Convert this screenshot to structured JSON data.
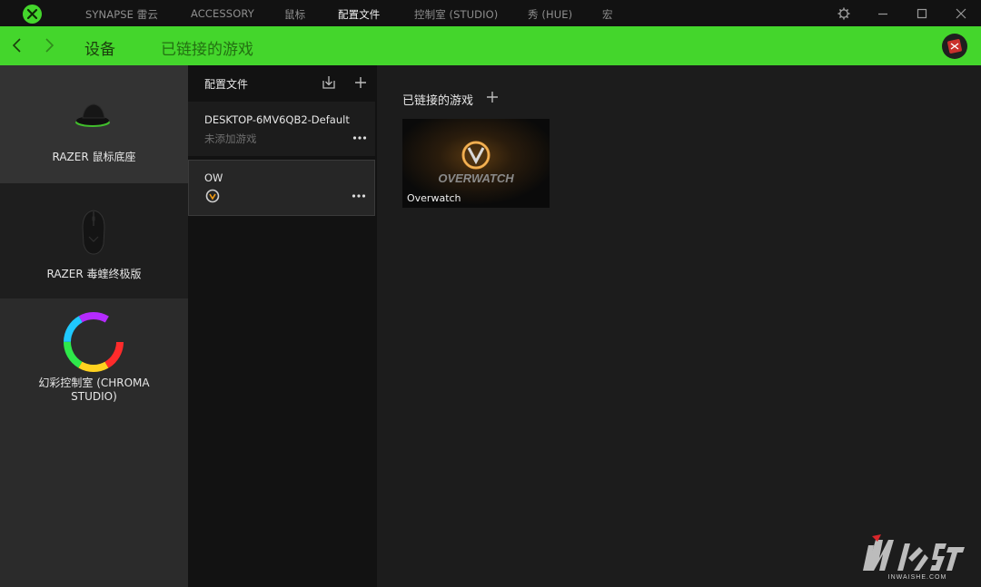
{
  "window": {
    "tabs": [
      {
        "label": "SYNAPSE 雷云"
      },
      {
        "label": "ACCESSORY"
      },
      {
        "label": "鼠标"
      },
      {
        "label": "配置文件"
      },
      {
        "label": "控制室 (STUDIO)"
      },
      {
        "label": "秀 (HUE)"
      },
      {
        "label": "宏"
      }
    ],
    "active_tab": "配置文件",
    "icons": [
      "razer-logo-icon",
      "gear-icon",
      "minimize-icon",
      "maximize-icon",
      "close-icon"
    ]
  },
  "subnav": {
    "tabs": [
      {
        "label": "设备"
      },
      {
        "label": "已链接的游戏"
      }
    ],
    "colors": {
      "bar": "#44d62c"
    }
  },
  "devices": [
    {
      "label": "RAZER 鼠标底座"
    },
    {
      "label": "RAZER 毒蝰终极版"
    },
    {
      "label": "幻彩控制室 (CHROMA STUDIO)"
    }
  ],
  "profiles": {
    "header": "配置文件",
    "items": [
      {
        "name": "DESKTOP-6MV6QB2-Default",
        "sub": "未添加游戏"
      },
      {
        "name": "OW",
        "sub": ""
      }
    ]
  },
  "linked_games": {
    "title": "已链接的游戏",
    "games": [
      {
        "name": "Overwatch",
        "banner_text": "OVERWATCH"
      }
    ]
  },
  "watermark": {
    "text": "INWAISHE.COM"
  }
}
